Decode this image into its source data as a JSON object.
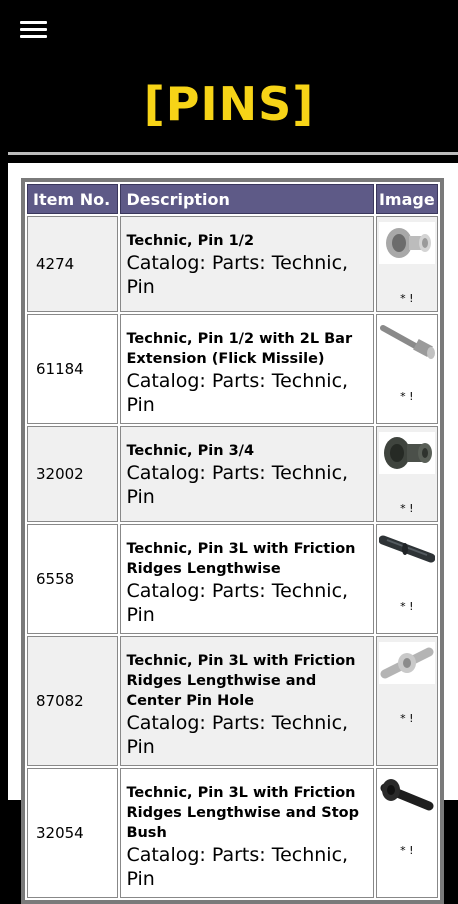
{
  "header": {
    "title": "[PINS]"
  },
  "table": {
    "columns": [
      "Item No.",
      "Description",
      "Image"
    ],
    "rows": [
      {
        "item_no": "4274",
        "name": "Technic, Pin 1/2",
        "catalog": "Catalog: Parts: Technic, Pin",
        "note": "* !",
        "icon": "pin-half-icon"
      },
      {
        "item_no": "61184",
        "name": "Technic, Pin 1/2 with 2L Bar Extension (Flick Missile)",
        "catalog": "Catalog: Parts: Technic, Pin",
        "note": "* !",
        "icon": "pin-bar-extension-icon"
      },
      {
        "item_no": "32002",
        "name": "Technic, Pin 3/4",
        "catalog": "Catalog: Parts: Technic, Pin",
        "note": "* !",
        "icon": "pin-three-quarter-icon"
      },
      {
        "item_no": "6558",
        "name": "Technic, Pin 3L with Friction Ridges Lengthwise",
        "catalog": "Catalog: Parts: Technic, Pin",
        "note": "* !",
        "icon": "pin-3l-friction-icon"
      },
      {
        "item_no": "87082",
        "name": "Technic, Pin 3L with Friction Ridges Lengthwise and Center Pin Hole",
        "catalog": "Catalog: Parts: Technic, Pin",
        "note": "* !",
        "icon": "pin-3l-center-hole-icon"
      },
      {
        "item_no": "32054",
        "name": "Technic, Pin 3L with Friction Ridges Lengthwise and Stop Bush",
        "catalog": "Catalog: Parts: Technic, Pin",
        "note": "* !",
        "icon": "pin-3l-stop-bush-icon"
      }
    ]
  },
  "colors": {
    "title": "#f7d417",
    "header_bg": "#5e5a87"
  }
}
